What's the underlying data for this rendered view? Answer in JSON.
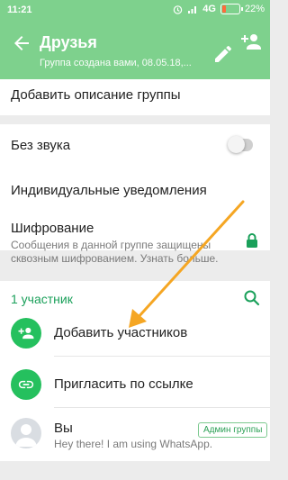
{
  "status_bar": {
    "time": "11:21",
    "network": "4G",
    "battery": "22%",
    "battery_level": 0.22
  },
  "app_bar": {
    "title": "Друзья",
    "subtitle": "Группа создана вами, 08.05.18,..."
  },
  "description_row": {
    "label": "Добавить описание группы"
  },
  "settings": {
    "mute": {
      "label": "Без звука",
      "enabled": false
    },
    "custom_notifications": {
      "label": "Индивидуальные уведомления"
    },
    "encryption": {
      "label": "Шифрование",
      "description": "Сообщения в данной группе защищены сквозным шифрованием. Узнать больше."
    }
  },
  "participants": {
    "count_label": "1 участник",
    "add_label": "Добавить участников",
    "invite_label": "Пригласить по ссылке",
    "members": [
      {
        "name": "Вы",
        "status": "Hey there! I am using WhatsApp.",
        "badge": "Админ группы"
      }
    ]
  },
  "colors": {
    "accent": "#7ed18d",
    "green": "#25c05e",
    "annotation_arrow": "#f5a623"
  }
}
